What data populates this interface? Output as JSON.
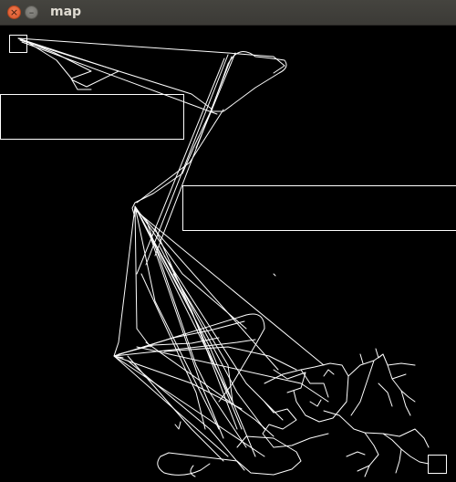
{
  "window": {
    "title": "map",
    "close_glyph": "×",
    "minimize_glyph": "–"
  },
  "map": {
    "background_color": "#000000",
    "line_color": "#ffffff"
  }
}
